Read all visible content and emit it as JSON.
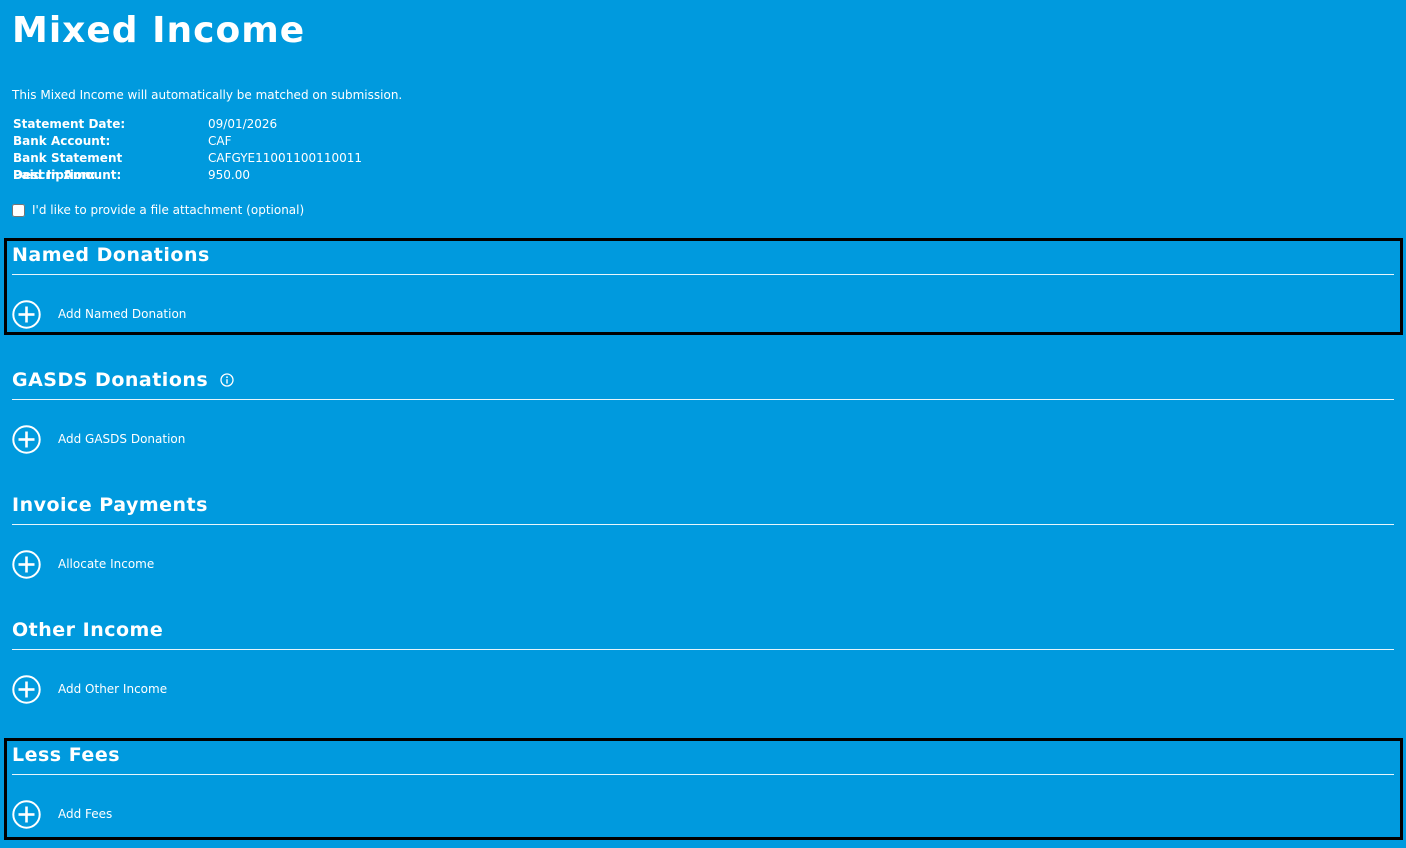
{
  "page": {
    "title": "Mixed Income",
    "info": "This Mixed Income will automatically be matched on submission."
  },
  "details": [
    {
      "label": "Statement Date:",
      "value": "09/01/2026"
    },
    {
      "label": "Bank Account:",
      "value": "CAF"
    },
    {
      "label": "Bank Statement Description:",
      "value": "CAFGYE11001100110011"
    },
    {
      "label": "Paid In Amount:",
      "value": "950.00"
    }
  ],
  "attachment": {
    "label": "I'd like to provide a file attachment (optional)",
    "checked": false
  },
  "sections": {
    "named": {
      "title": "Named Donations",
      "action": "Add Named Donation"
    },
    "gasds": {
      "title": "GASDS Donations",
      "action": "Add GASDS Donation"
    },
    "invoice": {
      "title": "Invoice Payments",
      "action": "Allocate Income"
    },
    "other": {
      "title": "Other Income",
      "action": "Add Other Income"
    },
    "fees": {
      "title": "Less Fees",
      "action": "Add Fees"
    }
  },
  "icons": {
    "add": "plus-circle-icon",
    "info": "info-circle-icon"
  },
  "colors": {
    "background": "#009ade",
    "text": "#ffffff",
    "highlight": "#000000"
  }
}
